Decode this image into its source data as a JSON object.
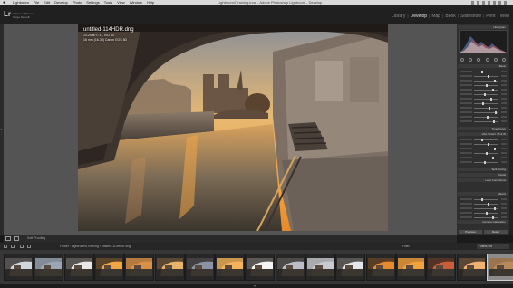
{
  "menu": {
    "apple": "",
    "items": [
      "Lightroom",
      "File",
      "Edit",
      "Develop",
      "Photo",
      "Settings",
      "Tools",
      "View",
      "Window",
      "Help"
    ],
    "window_title": "Lightroom4Training.lrcat - Adobe Photoshop Lightroom - Develop"
  },
  "identity": {
    "logo": "Lr",
    "line1": "Adobe Lightroom",
    "line2": "Serge Ramelli"
  },
  "modules": [
    {
      "label": "Library",
      "active": false
    },
    {
      "label": "Develop",
      "active": true
    },
    {
      "label": "Map",
      "active": false
    },
    {
      "label": "Book",
      "active": false
    },
    {
      "label": "Slideshow",
      "active": false
    },
    {
      "label": "Print",
      "active": false
    },
    {
      "label": "Web",
      "active": false
    }
  ],
  "photo_info": {
    "filename": "untitled-114HDR.dng",
    "line1": "1/125 at f / 11, ISO 50",
    "line2": "16 mm (16-35) Canon EOS 5D"
  },
  "right_panel": {
    "histogram_header": "Histogram",
    "basic_header": "Basic",
    "tone_curve_header": "Tone Curve",
    "hsl_header": "HSL / Color / B & W",
    "split_toning_header": "Split Toning",
    "detail_header": "Detail",
    "lens_header": "Lens Corrections",
    "effects_header": "Effects",
    "camera_header": "Camera Calibration",
    "previous_button": "Previous",
    "reset_button": "Reset"
  },
  "toolbar": {
    "soft_proofing_label": "Soft Proofing"
  },
  "filmstrip_bar": {
    "breadcrumb": "Folder : Lightroom4Training / untitled-114HDR.dng",
    "filter_label": "Filter :",
    "filter_value": "Filters Off"
  },
  "filmstrip": {
    "count": 17,
    "selected_index": 16
  },
  "colors": {
    "accent": "#ececec",
    "panel_bg": "#2f2f2f",
    "canvas_bg": "#545454"
  }
}
